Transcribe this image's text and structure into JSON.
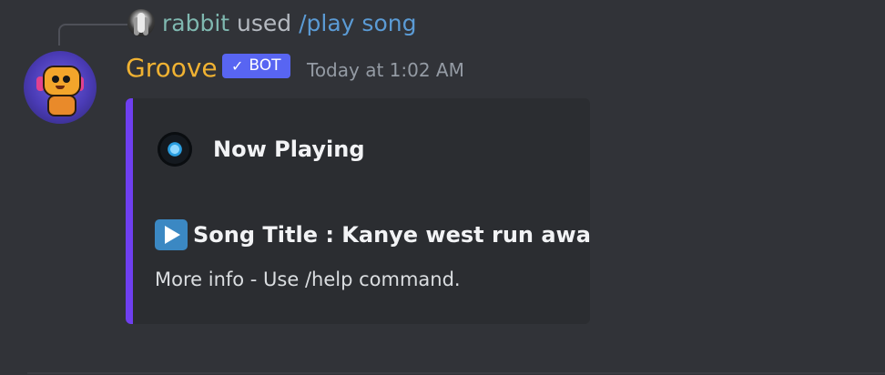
{
  "reply": {
    "username": "rabbit",
    "used_text": "used",
    "command": "/play song"
  },
  "message": {
    "author": "Groove",
    "bot_tag": "BOT",
    "timestamp": "Today at 1:02 AM",
    "author_color": "#f0b232",
    "bot_tag_color": "#5865f2"
  },
  "embed": {
    "accent_color": "#6f3ff0",
    "title_icon": "disc-icon",
    "title": "Now Playing",
    "song_icon": "play-button-icon",
    "song_line": "Song Title : Kanye west run away",
    "info_line": "More info - Use /help command."
  }
}
